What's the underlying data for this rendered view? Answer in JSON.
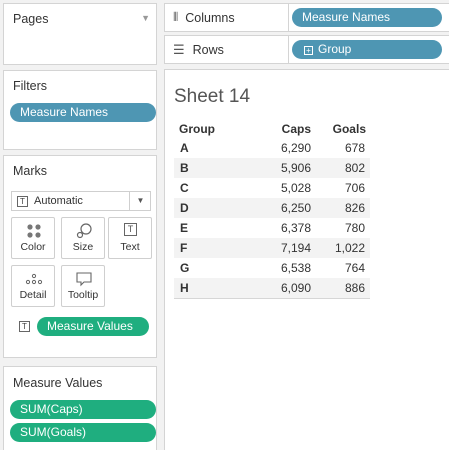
{
  "pages": {
    "title": "Pages"
  },
  "filters": {
    "title": "Filters",
    "pills": [
      "Measure Names"
    ]
  },
  "marks": {
    "title": "Marks",
    "mark_type": "Automatic",
    "buttons": [
      {
        "label": "Color",
        "icon": "color-dots-icon"
      },
      {
        "label": "Size",
        "icon": "size-icon"
      },
      {
        "label": "Text",
        "icon": "text-icon"
      },
      {
        "label": "Detail",
        "icon": "detail-icon"
      },
      {
        "label": "Tooltip",
        "icon": "tooltip-icon"
      }
    ],
    "field_pill": "Measure Values"
  },
  "measure_values": {
    "title": "Measure Values",
    "pills": [
      "SUM(Caps)",
      "SUM(Goals)"
    ]
  },
  "columns_shelf": {
    "label": "Columns",
    "pill": "Measure Names"
  },
  "rows_shelf": {
    "label": "Rows",
    "pill": "Group"
  },
  "sheet": {
    "title": "Sheet 14",
    "headers": [
      "Group",
      "Caps",
      "Goals"
    ],
    "rows": [
      [
        "A",
        "6,290",
        "678"
      ],
      [
        "B",
        "5,906",
        "802"
      ],
      [
        "C",
        "5,028",
        "706"
      ],
      [
        "D",
        "6,250",
        "826"
      ],
      [
        "E",
        "6,378",
        "780"
      ],
      [
        "F",
        "7,194",
        "1,022"
      ],
      [
        "G",
        "6,538",
        "764"
      ],
      [
        "H",
        "6,090",
        "886"
      ]
    ]
  },
  "colors": {
    "blue_pill": "#4e96b3",
    "green_pill": "#1fae7f"
  }
}
